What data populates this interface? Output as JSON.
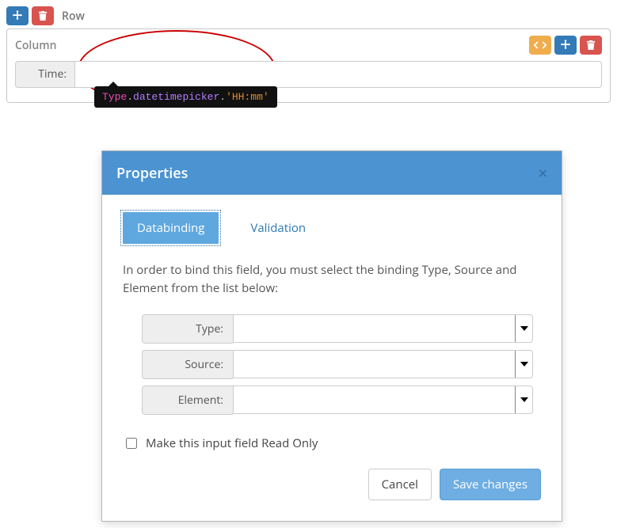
{
  "row": {
    "label": "Row"
  },
  "column": {
    "label": "Column",
    "field_label": "Time:"
  },
  "tooltip": {
    "type": "Type",
    "picker": "datetimepicker",
    "format": "'HH:mm'"
  },
  "modal": {
    "title": "Properties",
    "tabs": {
      "databinding": "Databinding",
      "validation": "Validation"
    },
    "intro": "In order to bind this field, you must select the binding Type, Source and Element from the list below:",
    "labels": {
      "type": "Type:",
      "source": "Source:",
      "element": "Element:"
    },
    "values": {
      "type": "",
      "source": "",
      "element": ""
    },
    "readonly_label": "Make this input field Read Only",
    "buttons": {
      "cancel": "Cancel",
      "save": "Save changes"
    }
  }
}
